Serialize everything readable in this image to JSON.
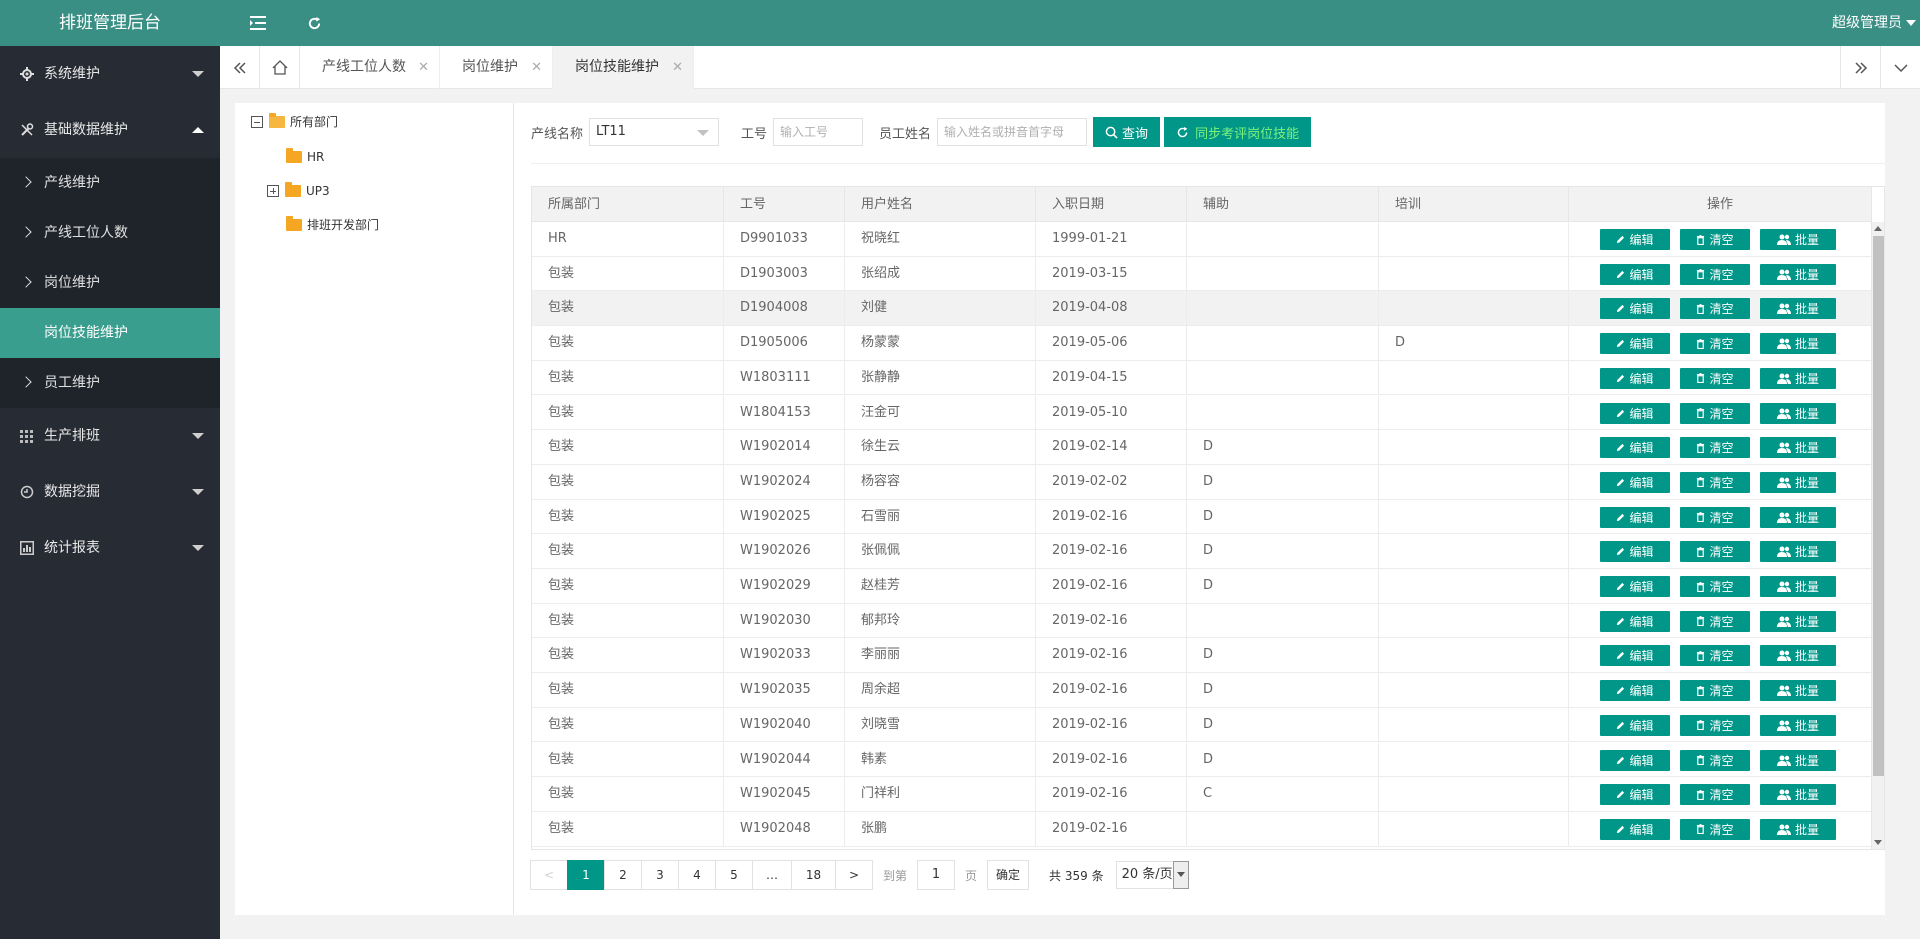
{
  "app": {
    "title": "排班管理后台",
    "user": "超级管理员"
  },
  "topbar": {
    "menu_icon": "menu-fold-icon",
    "refresh_icon": "refresh-icon"
  },
  "sidebar": {
    "groups": [
      {
        "label": "系统维护",
        "icon": "gear-icon",
        "expanded": false
      },
      {
        "label": "基础数据维护",
        "icon": "tools-icon",
        "expanded": true,
        "items": [
          "产线维护",
          "产线工位人数",
          "岗位维护",
          "岗位技能维护",
          "员工维护"
        ],
        "active_item": "岗位技能维护"
      },
      {
        "label": "生产排班",
        "icon": "grid-icon",
        "expanded": false
      },
      {
        "label": "数据挖掘",
        "icon": "mining-icon",
        "expanded": false
      },
      {
        "label": "统计报表",
        "icon": "report-icon",
        "expanded": false
      }
    ]
  },
  "tabs": {
    "items": [
      {
        "label": "产线工位人数",
        "active": false
      },
      {
        "label": "岗位维护",
        "active": false
      },
      {
        "label": "岗位技能维护",
        "active": true
      }
    ]
  },
  "tree": {
    "root": "所有部门",
    "children": [
      {
        "label": "HR",
        "expandable": false
      },
      {
        "label": "UP3",
        "expandable": true
      },
      {
        "label": "排班开发部门",
        "expandable": false
      }
    ]
  },
  "filters": {
    "line_label": "产线名称",
    "line_value": "LT11",
    "emp_no_label": "工号",
    "emp_no_placeholder": "输入工号",
    "emp_name_label": "员工姓名",
    "emp_name_placeholder": "输入姓名或拼音首字母",
    "query_button": "查询",
    "sync_button": "同步考评岗位技能"
  },
  "table": {
    "columns": [
      "所属部门",
      "工号",
      "用户姓名",
      "入职日期",
      "辅助",
      "培训",
      "操作"
    ],
    "actions": [
      "编辑",
      "清空",
      "批量"
    ],
    "rows": [
      [
        "HR",
        "D9901033",
        "祝晓红",
        "1999-01-21",
        "",
        ""
      ],
      [
        "包装",
        "D1903003",
        "张绍成",
        "2019-03-15",
        "",
        ""
      ],
      [
        "包装",
        "D1904008",
        "刘健",
        "2019-04-08",
        "",
        ""
      ],
      [
        "包装",
        "D1905006",
        "杨蒙蒙",
        "2019-05-06",
        "",
        "D"
      ],
      [
        "包装",
        "W1803111",
        "张静静",
        "2019-04-15",
        "",
        ""
      ],
      [
        "包装",
        "W1804153",
        "汪金可",
        "2019-05-10",
        "",
        ""
      ],
      [
        "包装",
        "W1902014",
        "徐生云",
        "2019-02-14",
        "D",
        ""
      ],
      [
        "包装",
        "W1902024",
        "杨容容",
        "2019-02-02",
        "D",
        ""
      ],
      [
        "包装",
        "W1902025",
        "石雪丽",
        "2019-02-16",
        "D",
        ""
      ],
      [
        "包装",
        "W1902026",
        "张佩佩",
        "2019-02-16",
        "D",
        ""
      ],
      [
        "包装",
        "W1902029",
        "赵桂芳",
        "2019-02-16",
        "D",
        ""
      ],
      [
        "包装",
        "W1902030",
        "郁邦玲",
        "2019-02-16",
        "",
        ""
      ],
      [
        "包装",
        "W1902033",
        "李丽丽",
        "2019-02-16",
        "D",
        ""
      ],
      [
        "包装",
        "W1902035",
        "周余超",
        "2019-02-16",
        "D",
        ""
      ],
      [
        "包装",
        "W1902040",
        "刘晓雪",
        "2019-02-16",
        "D",
        ""
      ],
      [
        "包装",
        "W1902044",
        "韩素",
        "2019-02-16",
        "D",
        ""
      ],
      [
        "包装",
        "W1902045",
        "门祥利",
        "2019-02-16",
        "C",
        ""
      ],
      [
        "包装",
        "W1902048",
        "张鹏",
        "2019-02-16",
        "",
        ""
      ]
    ],
    "highlighted_row": 2
  },
  "pager": {
    "prev": "<",
    "pages": [
      "1",
      "2",
      "3",
      "4",
      "5",
      "…",
      "18"
    ],
    "current": "1",
    "next": ">",
    "goto_prefix": "到第",
    "goto_value": "1",
    "goto_suffix": "页",
    "confirm": "确定",
    "total": "共 359 条",
    "limit": "20 条/页"
  },
  "colors": {
    "primary": "#009688",
    "topbar": "#3a8f84",
    "sidebar": "#272b33",
    "active_nav": "#3a9e8f"
  }
}
